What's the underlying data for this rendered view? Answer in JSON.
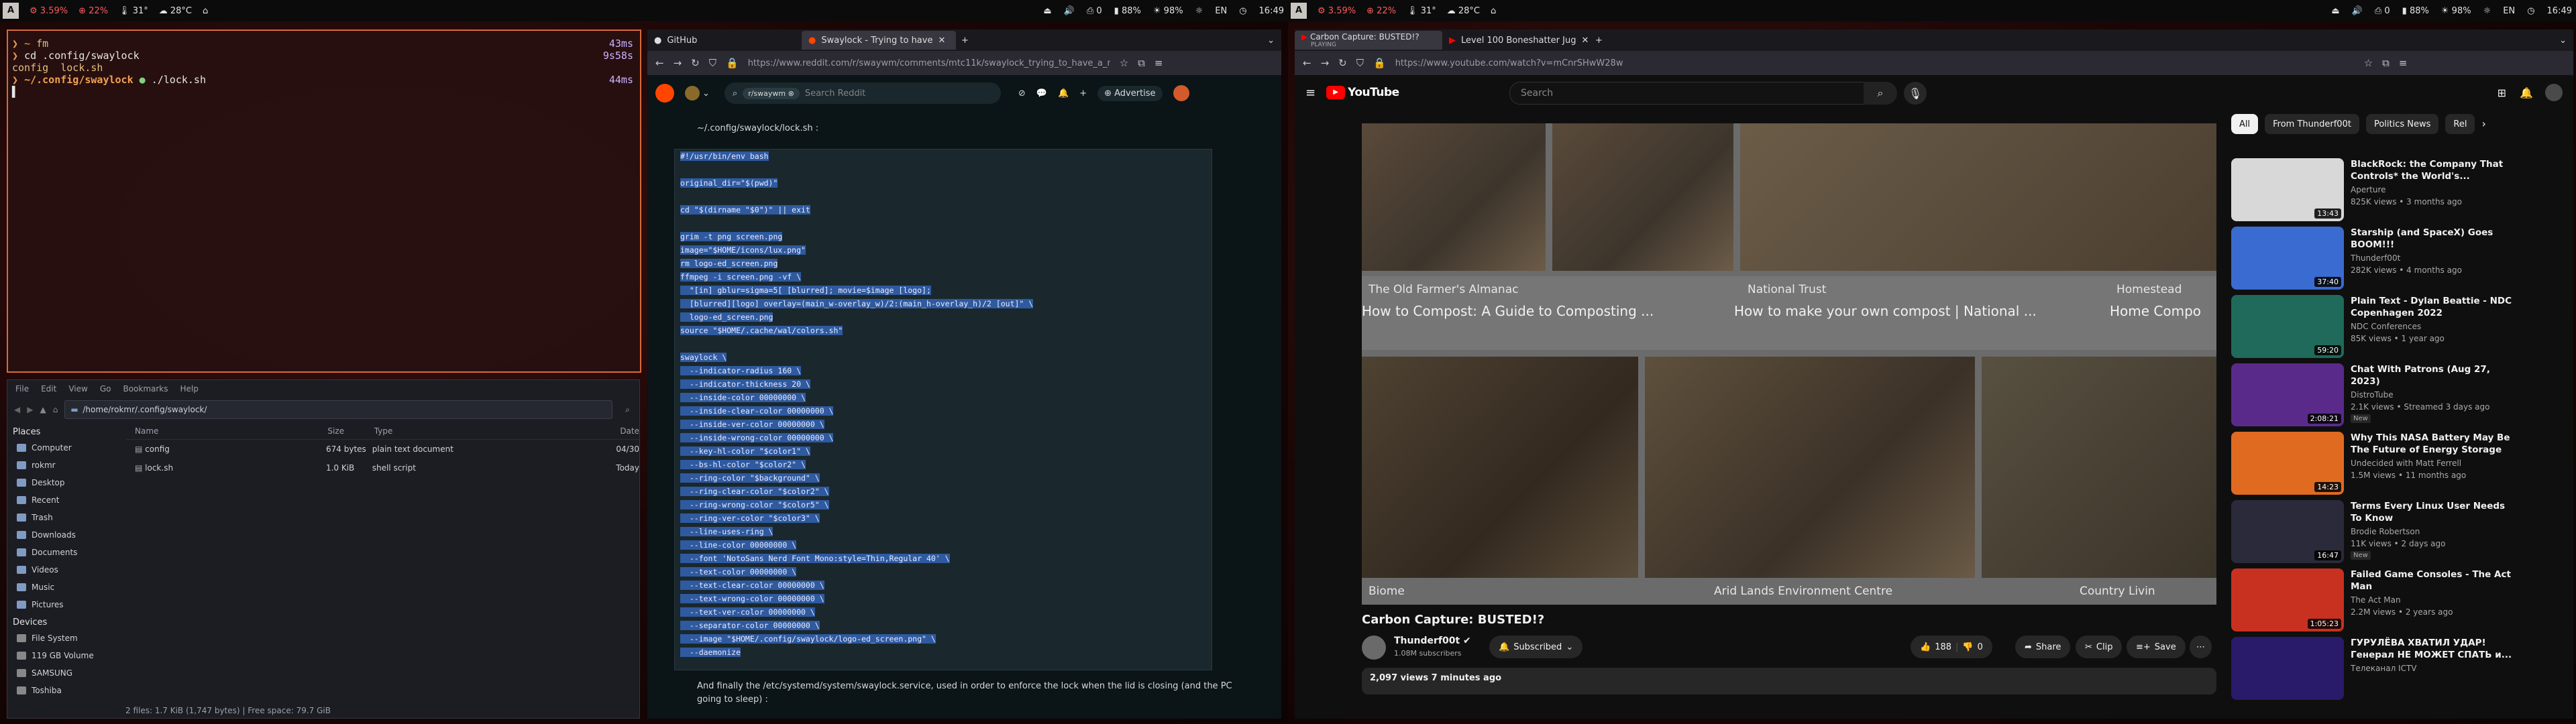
{
  "statusbar_left": {
    "workspace": "A",
    "cpu": "3.59%",
    "mem": "22%",
    "temp_gpu": "31°",
    "weather": "28°C",
    "battery": "88%",
    "brightness": "98%",
    "lang": "EN",
    "clock": "16:49"
  },
  "statusbar_right": {
    "workspace": "A",
    "cpu": "3.59%",
    "mem": "22%",
    "temp_gpu": "31°",
    "weather": "28°C",
    "battery": "88%",
    "brightness": "98%",
    "lang": "EN",
    "clock": "16:49"
  },
  "terminal": {
    "line1_prompt": "~",
    "line1_cmd": "fm",
    "line2_cmd": "cd .config/swaylock",
    "line3": "config  lock.sh",
    "line4_path": "~/.config/swaylock",
    "line4_cmd": "./lock.sh",
    "times": [
      "43ms",
      "9s58s",
      "44ms"
    ]
  },
  "filemanager": {
    "menu": [
      "File",
      "Edit",
      "View",
      "Go",
      "Bookmarks",
      "Help"
    ],
    "path": "/home/rokmr/.config/swaylock/",
    "places_header": "Places",
    "places": [
      "Computer",
      "rokmr",
      "Desktop",
      "Recent",
      "Trash",
      "Downloads",
      "Documents",
      "Videos",
      "Music",
      "Pictures"
    ],
    "devices_header": "Devices",
    "devices": [
      "File System",
      "119 GB Volume",
      "SAMSUNG",
      "Toshiba"
    ],
    "columns": [
      "Name",
      "Size",
      "Type",
      "Date"
    ],
    "rows": [
      {
        "name": "config",
        "size": "674 bytes",
        "type": "plain text document",
        "date": "04/30"
      },
      {
        "name": "lock.sh",
        "size": "1.0 KiB",
        "type": "shell script",
        "date": "Today"
      }
    ],
    "status": "2 files: 1.7 KiB (1,747 bytes)  |  Free space: 79.7 GiB"
  },
  "browser_reddit": {
    "tabs": [
      "GitHub",
      "Swaylock - Trying to have"
    ],
    "url": "https://www.reddit.com/r/swaywm/comments/mtc11k/swaylock_trying_to_have_a_ni",
    "subreddit": "r/swaywm",
    "search_placeholder": "Search Reddit",
    "advertise": "Advertise",
    "file_label": "~/.config/swaylock/lock.sh :",
    "code_lines": [
      "#!/usr/bin/env bash",
      "",
      "original_dir=\"$(pwd)\"",
      "",
      "cd \"$(dirname \"$0\")\" || exit",
      "",
      "grim -t png screen.png",
      "image=\"$HOME/icons/lux.png\"",
      "rm logo-ed_screen.png",
      "ffmpeg -i screen.png -vf \\",
      "  \"[in] gblur=sigma=5[ [blurred]; movie=$image [logo];",
      "  [blurred][logo] overlay=(main_w-overlay_w)/2:(main_h-overlay_h)/2 [out]\" \\",
      "  logo-ed_screen.png",
      "source \"$HOME/.cache/wal/colors.sh\"",
      "",
      "swaylock \\",
      "  --indicator-radius 160 \\",
      "  --indicator-thickness 20 \\",
      "  --inside-color 00000000 \\",
      "  --inside-clear-color 00000000 \\",
      "  --inside-ver-color 00000000 \\",
      "  --inside-wrong-color 00000000 \\",
      "  --key-hl-color \"$color1\" \\",
      "  --bs-hl-color \"$color2\" \\",
      "  --ring-color \"$background\" \\",
      "  --ring-clear-color \"$color2\" \\",
      "  --ring-wrong-color \"$color5\" \\",
      "  --ring-ver-color \"$color3\" \\",
      "  --line-uses-ring \\",
      "  --line-color 00000000 \\",
      "  --font 'NotoSans Nerd Font Mono:style=Thin,Regular 40' \\",
      "  --text-color 00000000 \\",
      "  --text-clear-color 00000000 \\",
      "  --text-wrong-color 00000000 \\",
      "  --text-ver-color 00000000 \\",
      "  --separator-color 00000000 \\",
      "  --image \"$HOME/.config/swaylock/logo-ed_screen.png\" \\",
      "  --daemonize"
    ],
    "footer_text": "And finally the /etc/systemd/system/swaylock.service, used in order to enforce the lock when the lid is closing (and the PC going to sleep) :"
  },
  "browser_youtube": {
    "tabs": [
      "Carbon Capture: BUSTED!?",
      "Level 100 Boneshatter Jug"
    ],
    "tab_sub": "PLAYING",
    "url": "https://www.youtube.com/watch?v=mCnrSHwW28w",
    "logo_text": "YouTube",
    "search_placeholder": "Search",
    "tiles": [
      {
        "source": "The Old Farmer's Almanac",
        "caption": "How to Compost: A Guide to Composting ..."
      },
      {
        "source": "National Trust",
        "caption": "How to make your own compost | National ..."
      },
      {
        "source": "Homestead",
        "caption": "Home Compo"
      },
      {
        "source": "Biome",
        "caption": ""
      },
      {
        "source": "Arid Lands Environment Centre",
        "caption": ""
      },
      {
        "source": "Country Livin",
        "caption": ""
      }
    ],
    "video_title": "Carbon Capture: BUSTED!?",
    "channel": "Thunderf00t",
    "subscribers": "1.08M subscribers",
    "subscribed_label": "Subscribed",
    "likes": "188",
    "dislikes": "0",
    "share": "Share",
    "clip": "Clip",
    "save": "Save",
    "views_line": "2,097 views  7 minutes ago",
    "chips": [
      "All",
      "From Thunderf00t",
      "Politics News",
      "Rel"
    ],
    "recommendations": [
      {
        "title": "BlackRock: the Company That Controls* the World's...",
        "channel": "Aperture",
        "meta": "825K views • 3 months ago",
        "duration": "13:43",
        "badge": ""
      },
      {
        "title": "Starship (and SpaceX) Goes BOOM!!!",
        "channel": "Thunderf00t",
        "meta": "282K views • 4 months ago",
        "duration": "37:40",
        "badge": ""
      },
      {
        "title": "Plain Text - Dylan Beattie - NDC Copenhagen 2022",
        "channel": "NDC Conferences",
        "meta": "85K views • 1 year ago",
        "duration": "59:20",
        "badge": ""
      },
      {
        "title": "Chat With Patrons (Aug 27, 2023)",
        "channel": "DistroTube",
        "meta": "2.1K views • Streamed 3 days ago",
        "duration": "2:08:21",
        "badge": "New"
      },
      {
        "title": "Why This NASA Battery May Be The Future of Energy Storage",
        "channel": "Undecided with Matt Ferrell",
        "meta": "1.5M views • 11 months ago",
        "duration": "14:23",
        "badge": ""
      },
      {
        "title": "Terms Every Linux User Needs To Know",
        "channel": "Brodie Robertson",
        "meta": "11K views • 2 days ago",
        "duration": "16:47",
        "badge": "New"
      },
      {
        "title": "Failed Game Consoles - The Act Man",
        "channel": "The Act Man",
        "meta": "2.2M views • 2 years ago",
        "duration": "1:05:23",
        "badge": ""
      },
      {
        "title": "ГУРУЛЁВА ХВАТИЛ УДАР! Генерал НЕ МОЖЕТ СПАТЬ и...",
        "channel": "Телеканал ICTV",
        "meta": "",
        "duration": "",
        "badge": ""
      }
    ]
  },
  "colors": {
    "accent_border": "#d96a3a",
    "reddit_orange": "#ff4500",
    "youtube_red": "#ff0000",
    "selection_blue": "#2f5aa0"
  }
}
